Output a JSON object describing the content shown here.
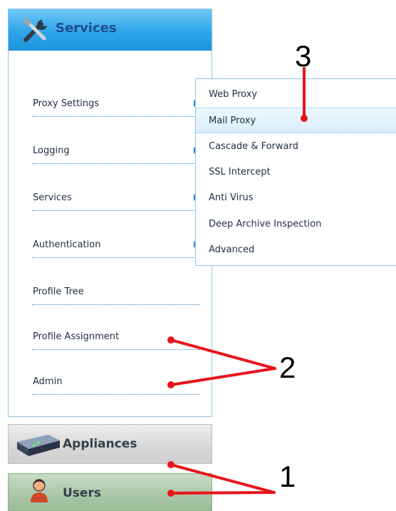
{
  "panel": {
    "title": "Services",
    "icon": "tools-icon",
    "items": [
      {
        "label": "Proxy Settings",
        "has_submenu": true
      },
      {
        "label": "Logging",
        "has_submenu": true
      },
      {
        "label": "Services",
        "has_submenu": true
      },
      {
        "label": "Authentication",
        "has_submenu": true
      },
      {
        "label": "Profile Tree",
        "has_submenu": false
      },
      {
        "label": "Profile Assignment",
        "has_submenu": false
      },
      {
        "label": "Admin",
        "has_submenu": false
      }
    ]
  },
  "submenu": {
    "items": [
      {
        "label": "Web Proxy"
      },
      {
        "label": "Mail Proxy",
        "active": true
      },
      {
        "label": "Cascade & Forward"
      },
      {
        "label": "SSL Intercept"
      },
      {
        "label": "Anti Virus"
      },
      {
        "label": "Deep Archive Inspection"
      },
      {
        "label": "Advanced"
      }
    ]
  },
  "tabs": {
    "appliances": {
      "label": "Appliances",
      "icon": "appliance-icon"
    },
    "users": {
      "label": "Users",
      "icon": "user-icon"
    }
  },
  "annotations": {
    "label_1": "1",
    "label_2": "2",
    "label_3": "3",
    "color": "#e8141c"
  }
}
